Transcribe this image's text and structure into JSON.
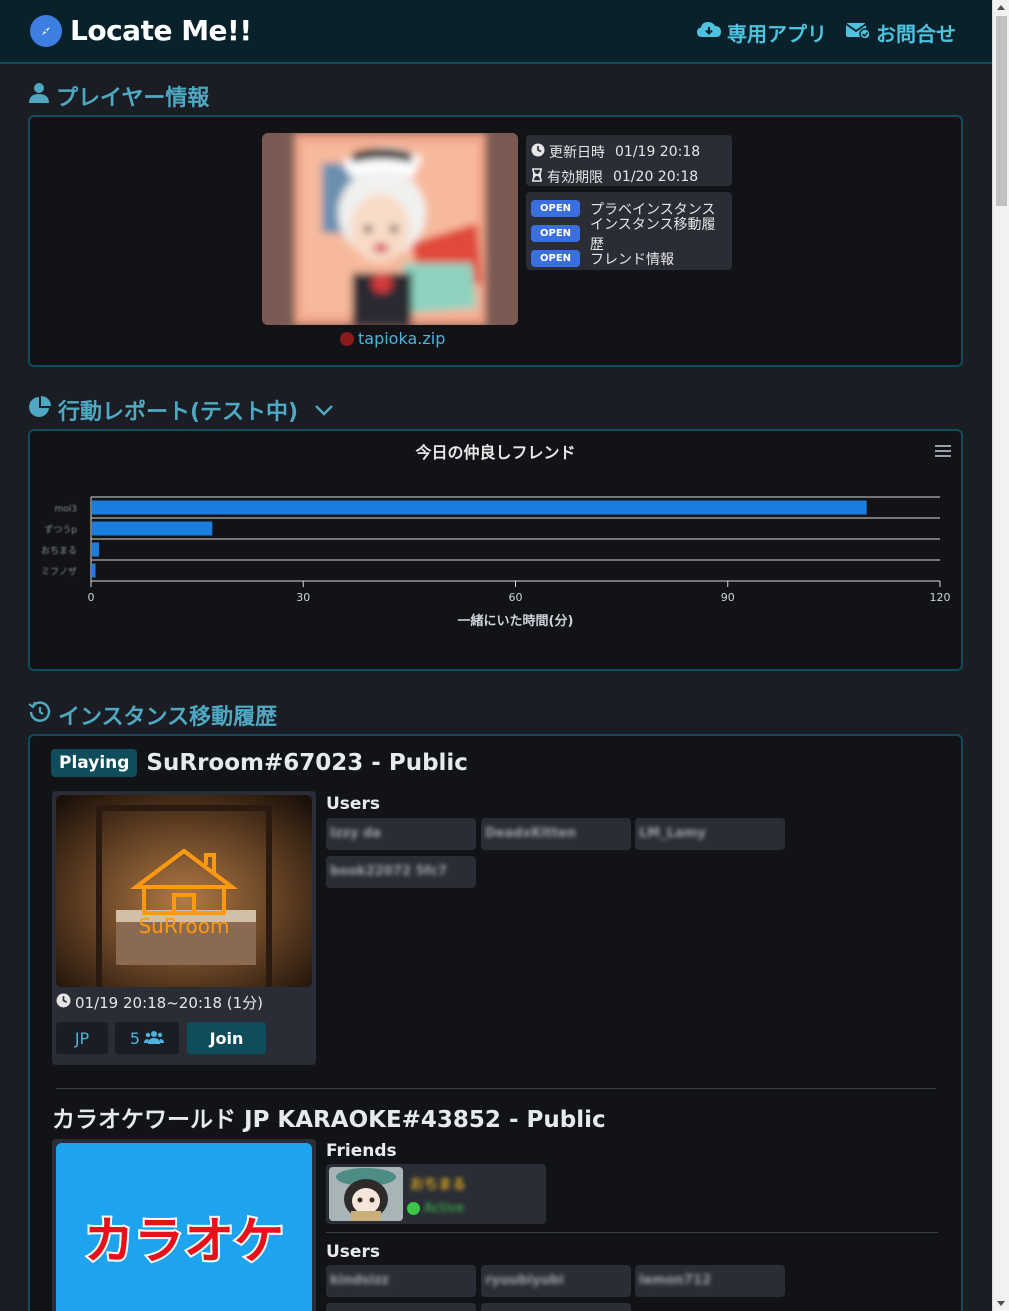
{
  "navbar": {
    "brand": "Locate Me!!",
    "links": [
      {
        "label": "専用アプリ",
        "icon": "cloud-download-icon"
      },
      {
        "label": "お問合せ",
        "icon": "mail-check-icon"
      }
    ]
  },
  "player_section": {
    "heading": "プレイヤー情報",
    "name": "tapioka.zip",
    "status_color": "#8b1a1a",
    "updated": {
      "label": "更新日時",
      "value": "01/19 20:18"
    },
    "expires": {
      "label": "有効期限",
      "value": "01/20 20:18"
    },
    "permissions": [
      {
        "badge": "OPEN",
        "label": "プラベインスタンス"
      },
      {
        "badge": "OPEN",
        "label": "インスタンス移動履歴"
      },
      {
        "badge": "OPEN",
        "label": "フレンド情報"
      }
    ]
  },
  "report_section": {
    "heading": "行動レポート(テスト中)"
  },
  "chart_data": {
    "type": "bar",
    "orientation": "horizontal",
    "title": "今日の仲良しフレンド",
    "xlabel": "一緒にいた時間(分)",
    "ylabel": "",
    "categories": [
      "mol3",
      "ずつうp",
      "おちまる",
      "ミフノザ"
    ],
    "values": [
      109.5,
      17,
      1,
      0.5
    ],
    "xlim": [
      0,
      120
    ],
    "xticks": [
      "0",
      "30",
      "60",
      "90",
      "120"
    ],
    "bar_color": "#1a7de0",
    "grid": true
  },
  "history_section": {
    "heading": "インスタンス移動履歴",
    "instances": [
      {
        "status": "Playing",
        "title": "SuRroom#67023 - Public",
        "thumb_text": "SuRroom",
        "time": "01/19 20:18~20:18 (1分)",
        "region": "JP",
        "user_count": "5",
        "join_label": "Join",
        "users_label": "Users",
        "users": [
          "Izzy da",
          "DeadxKitten",
          "LM_Lamy",
          "book22072 5fc7"
        ]
      },
      {
        "title": "カラオケワールド JP KARAOKE#43852 - Public",
        "thumb_text": "カラオケ",
        "friends_label": "Friends",
        "friends": [
          {
            "name": "おちまる",
            "status": "Active"
          }
        ],
        "users_label": "Users",
        "users": [
          "kindsizz",
          "ryuubiyubi",
          "lemon712"
        ]
      }
    ]
  }
}
